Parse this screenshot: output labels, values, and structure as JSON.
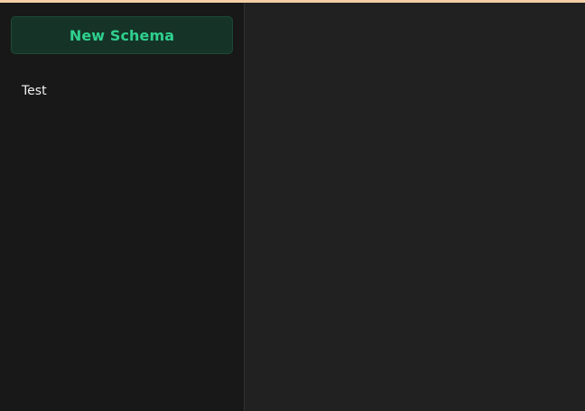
{
  "sidebar": {
    "new_schema_label": "New Schema",
    "items": [
      {
        "label": "Test"
      }
    ]
  },
  "colors": {
    "top_accent": "#f3cfa6",
    "sidebar_bg": "#181818",
    "main_bg": "#212121",
    "button_bg": "#153427",
    "button_text": "#2fd08e",
    "item_text": "#f1f1f1"
  }
}
